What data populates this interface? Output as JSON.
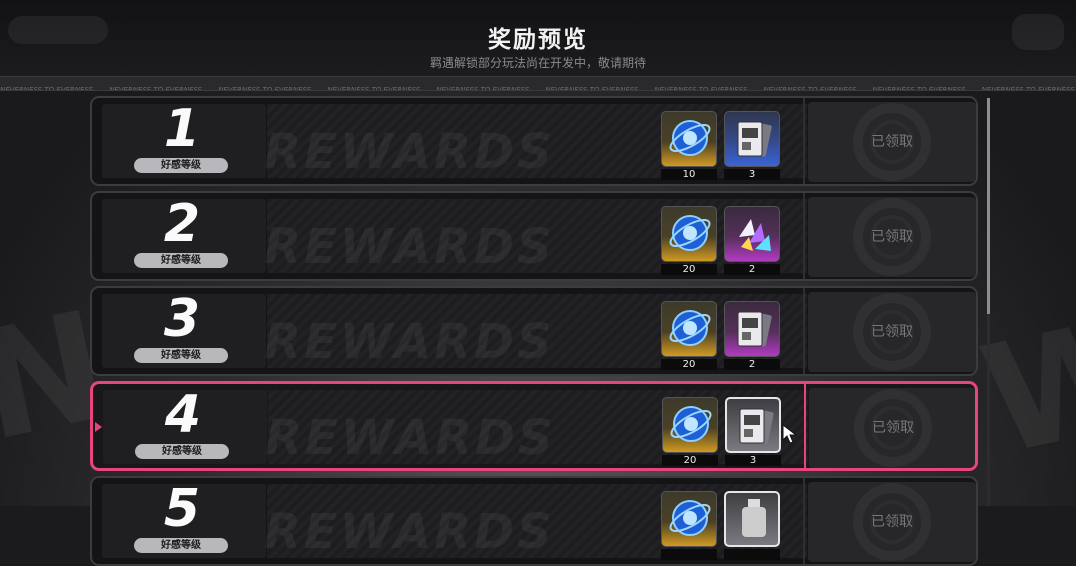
{
  "header": {
    "title": "奖励预览",
    "subtitle": "羁遇解锁部分玩法尚在开发中，敬请期待"
  },
  "ticker_text": "NEVERNESS TO EVERNESS",
  "watermark": "REWARDS",
  "level_label": "好感等级",
  "claim_label": "已领取",
  "rows": [
    {
      "level": "1",
      "claimed": true,
      "selected": false,
      "items": [
        {
          "icon": "blue-orb-icon",
          "rarity": "gold",
          "qty": "10"
        },
        {
          "icon": "card-pack-icon",
          "rarity": "blue",
          "qty": "3"
        }
      ]
    },
    {
      "level": "2",
      "claimed": true,
      "selected": false,
      "items": [
        {
          "icon": "blue-orb-icon",
          "rarity": "gold",
          "qty": "20"
        },
        {
          "icon": "crystal-cluster-icon",
          "rarity": "purple",
          "qty": "2"
        }
      ]
    },
    {
      "level": "3",
      "claimed": true,
      "selected": false,
      "items": [
        {
          "icon": "blue-orb-icon",
          "rarity": "gold",
          "qty": "20"
        },
        {
          "icon": "card-pack-icon",
          "rarity": "purple",
          "qty": "2"
        }
      ]
    },
    {
      "level": "4",
      "claimed": true,
      "selected": true,
      "items": [
        {
          "icon": "blue-orb-icon",
          "rarity": "gold",
          "qty": "20"
        },
        {
          "icon": "card-pack-icon",
          "rarity": "grey",
          "qty": "3"
        }
      ]
    },
    {
      "level": "5",
      "claimed": true,
      "selected": false,
      "items": [
        {
          "icon": "blue-orb-icon",
          "rarity": "gold",
          "qty": ""
        },
        {
          "icon": "bottle-icon",
          "rarity": "grey",
          "qty": ""
        }
      ]
    }
  ],
  "colors": {
    "accent": "#e8457f",
    "gold": "#d09a22",
    "blue": "#3a63d6",
    "purple": "#b23ac2"
  }
}
